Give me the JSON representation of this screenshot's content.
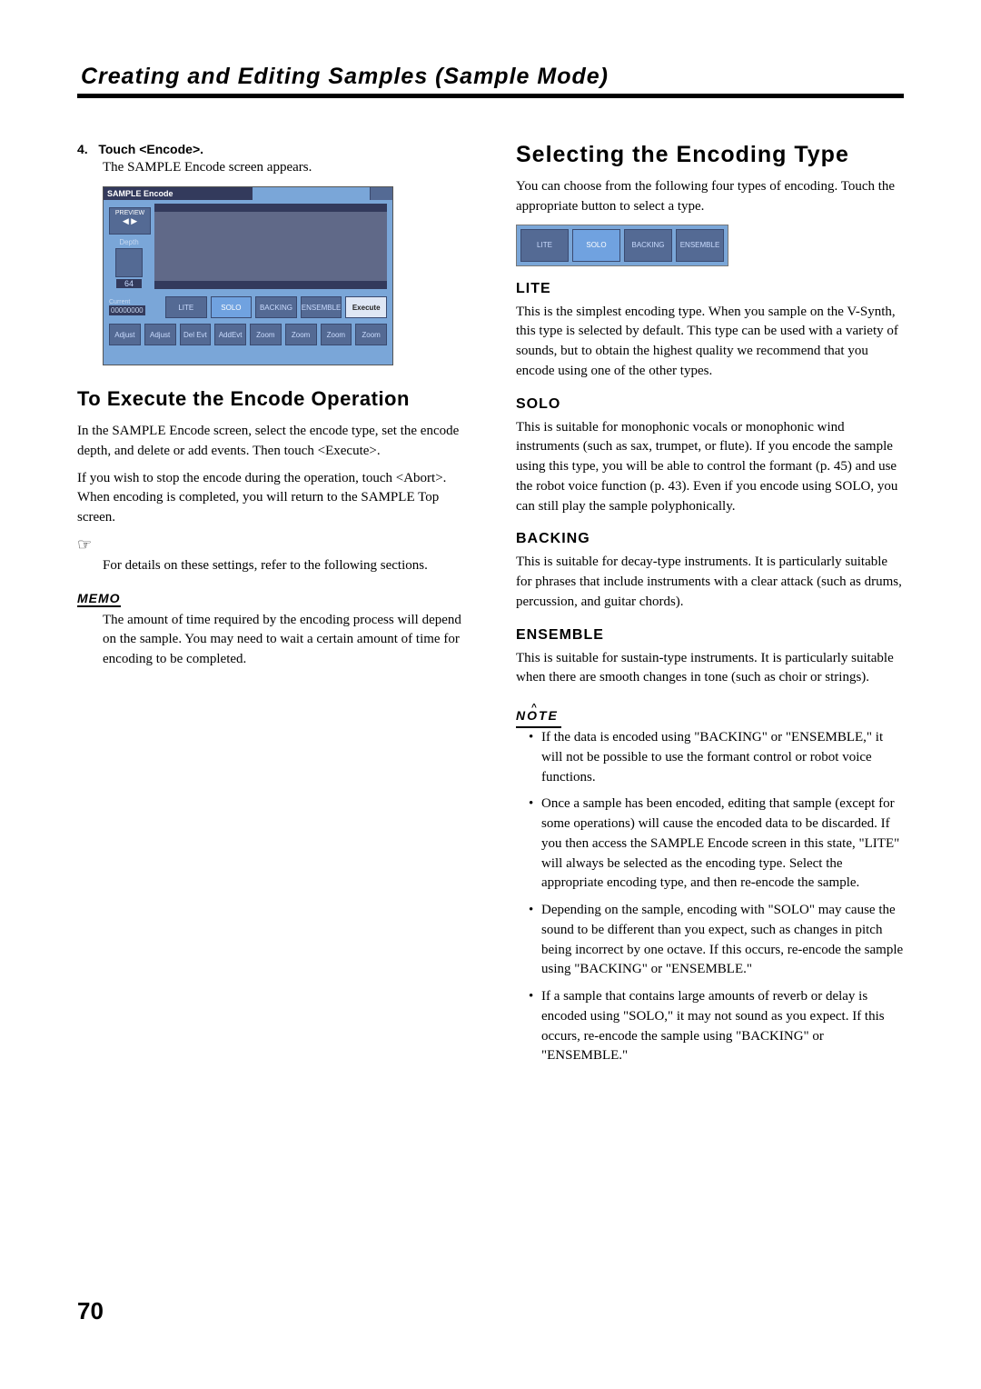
{
  "header": {
    "title": "Creating and Editing Samples (Sample Mode)"
  },
  "left": {
    "step_num": "4.",
    "step_label": "Touch <Encode>.",
    "step_desc": "The SAMPLE Encode screen appears.",
    "ss": {
      "title": "SAMPLE Encode",
      "preview": "PREVIEW",
      "depth_label": "Depth",
      "depth_value": "64",
      "current_label": "Current",
      "current_value": "00000000",
      "r1": {
        "lite": "LITE",
        "solo": "SOLO",
        "backing": "BACKING",
        "ensemble": "ENSEMBLE",
        "execute": "Execute"
      },
      "r2": {
        "a": "Adjust",
        "b": "Adjust",
        "c": "Del Evt",
        "d": "AddEvt",
        "e": "Zoom",
        "f": "Zoom",
        "g": "Zoom",
        "h": "Zoom"
      }
    },
    "h3": "To Execute the Encode Operation",
    "p1": "In the SAMPLE Encode screen, select the encode type, set the encode depth, and delete or add events. Then touch <Execute>.",
    "p2": "If you wish to stop the encode during the operation, touch <Abort>. When encoding is completed, you will return to the SAMPLE Top screen.",
    "hand": "☞",
    "hand_text": "For details on these settings, refer to the following sections.",
    "memo": "MEMO",
    "memo_text": "The amount of time required by the encoding process will depend on the sample. You may need to wait a certain amount of time for encoding to be completed."
  },
  "right": {
    "h2": "Selecting the Encoding Type",
    "intro": "You can choose from the following four types of encoding. Touch the appropriate button to select a type.",
    "enc_row": {
      "lite": "LITE",
      "solo": "SOLO",
      "backing": "BACKING",
      "ensemble": "ENSEMBLE"
    },
    "sec": {
      "lite": {
        "h": "LITE",
        "p": "This is the simplest encoding type. When you sample on the V-Synth, this type is selected by default. This type can be used with a variety of sounds, but to obtain the highest quality we recommend that you encode using one of the other types."
      },
      "solo": {
        "h": "SOLO",
        "p": "This is suitable for monophonic vocals or monophonic wind instruments (such as sax, trumpet, or flute). If you encode the sample using this type, you will be able to control the formant (p. 45) and use the robot voice function (p. 43). Even if you encode using SOLO, you can still play the sample polyphonically."
      },
      "backing": {
        "h": "BACKING",
        "p": "This is suitable for decay-type instruments. It is particularly suitable for phrases that include instruments with a clear attack (such as drums, percussion, and guitar chords)."
      },
      "ensemble": {
        "h": "ENSEMBLE",
        "p": "This is suitable for sustain-type instruments. It is particularly suitable when there are smooth changes in tone (such as choir or strings)."
      }
    },
    "note_label": "NOTE",
    "notes": {
      "n1": "If the data is encoded using \"BACKING\" or \"ENSEMBLE,\" it will not be possible to use the formant control or robot voice functions.",
      "n2": "Once a sample has been encoded, editing that sample (except for some operations) will cause the encoded data to be discarded. If you then access the SAMPLE Encode screen in this state, \"LITE\" will always be selected as the encoding type. Select the appropriate encoding type, and then re-encode the sample.",
      "n3": "Depending on the sample, encoding with \"SOLO\" may cause the sound to be different than you expect, such as changes in pitch being incorrect by one octave. If this occurs, re-encode the sample using \"BACKING\" or \"ENSEMBLE.\"",
      "n4": "If a sample that contains large amounts of reverb or delay is encoded using \"SOLO,\" it may not sound as you expect. If this occurs, re-encode the sample using \"BACKING\" or \"ENSEMBLE.\""
    }
  },
  "page_number": "70"
}
